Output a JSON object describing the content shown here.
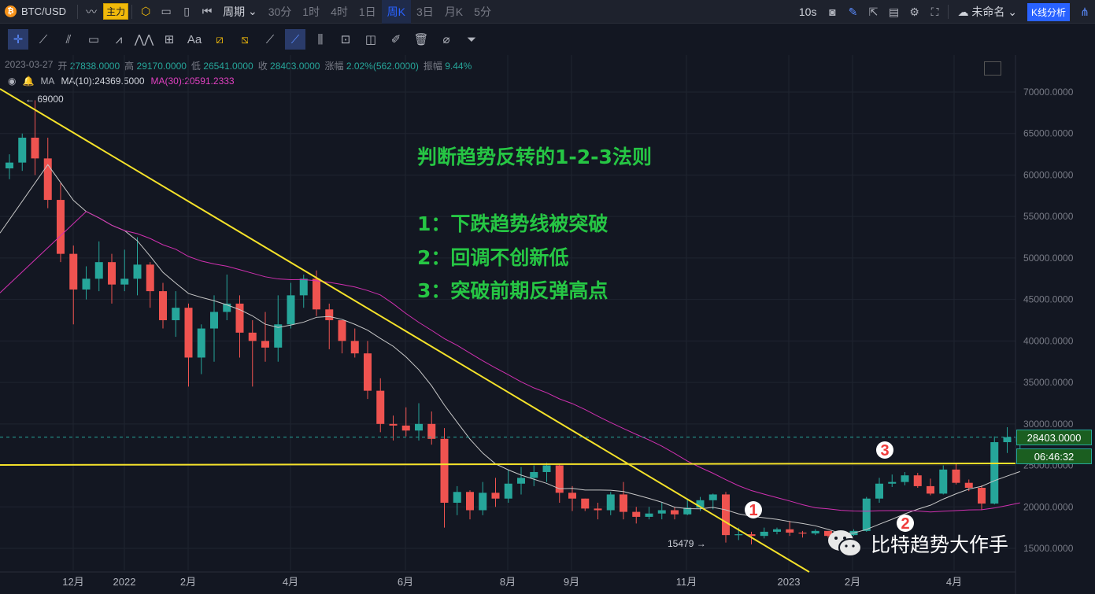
{
  "toolbar": {
    "symbol": "BTC/USD",
    "indicator_label": "主力",
    "period_label": "周期",
    "intervals": [
      "30分",
      "1时",
      "4时",
      "1日",
      "周K",
      "3日",
      "月K",
      "5分"
    ],
    "active_interval": "周K",
    "refresh": "10s",
    "layout_name": "未命名",
    "analysis_button": "K线分析"
  },
  "drawing_tools": [
    "crosshair",
    "trend-line",
    "ray",
    "rectangle",
    "pitchfork",
    "pattern",
    "measure",
    "text",
    "ruler",
    "fib",
    "brush",
    "magnet",
    "bars",
    "lock",
    "note",
    "edit",
    "delete",
    "magnet-2",
    "filter"
  ],
  "ohlc": {
    "date": "2023-03-27",
    "open_label": "开",
    "open": "27838.0000",
    "high_label": "高",
    "high": "29170.0000",
    "low_label": "低",
    "low": "26541.0000",
    "close_label": "收",
    "close": "28403.0000",
    "change_label": "涨幅",
    "change": "2.02%(562.0000)",
    "amplitude_label": "振幅",
    "amplitude": "9.44%"
  },
  "ma": {
    "label": "MA",
    "ma10": "MA(10):24369.5000",
    "ma30": "MA(30):20591.2333"
  },
  "annotations": {
    "title": "判断趋势反转的1-2-3法则",
    "rule1": "1：下跌趋势线被突破",
    "rule2": "2：回调不创新低",
    "rule3": "3：突破前期反弹高点"
  },
  "watermark": "比特趋势大作手",
  "price_labels": {
    "last": "28403.0000",
    "countdown": "06:46:32"
  },
  "chart_data": {
    "type": "candlestick",
    "y_ticks": [
      "70000.0000",
      "65000.0000",
      "60000.0000",
      "55000.0000",
      "50000.0000",
      "45000.0000",
      "40000.0000",
      "35000.0000",
      "30000.0000",
      "25000.0000",
      "20000.0000",
      "15000.0000"
    ],
    "ylim": [
      12000,
      74000
    ],
    "x_ticks": [
      "12月",
      "2022",
      "2月",
      "4月",
      "6月",
      "8月",
      "9月",
      "11月",
      "2023",
      "2月",
      "4月"
    ],
    "high_marker": "69000",
    "low_marker": "15479",
    "markers": [
      "1",
      "2",
      "3"
    ],
    "candles": [
      [
        60800,
        61500,
        59500,
        62500
      ],
      [
        61500,
        64500,
        60500,
        65000
      ],
      [
        64500,
        62000,
        60000,
        69000
      ],
      [
        62000,
        57000,
        56000,
        64500
      ],
      [
        57000,
        50500,
        49500,
        59000
      ],
      [
        50500,
        46200,
        42000,
        51500
      ],
      [
        46200,
        47500,
        45000,
        49000
      ],
      [
        47500,
        49500,
        46000,
        52000
      ],
      [
        49500,
        46800,
        44500,
        50500
      ],
      [
        46800,
        47500,
        46000,
        51000
      ],
      [
        47500,
        49200,
        45500,
        52500
      ],
      [
        49200,
        46000,
        44000,
        49500
      ],
      [
        46000,
        42500,
        41500,
        47000
      ],
      [
        42500,
        44000,
        40500,
        46000
      ],
      [
        44000,
        38000,
        34500,
        44500
      ],
      [
        38000,
        41500,
        36000,
        42000
      ],
      [
        41500,
        43500,
        37500,
        45500
      ],
      [
        43500,
        44500,
        42500,
        48000
      ],
      [
        44500,
        41000,
        38000,
        45500
      ],
      [
        41000,
        40000,
        34500,
        42500
      ],
      [
        40000,
        39200,
        37500,
        43500
      ],
      [
        39200,
        42000,
        37500,
        45500
      ],
      [
        42000,
        45500,
        41500,
        47000
      ],
      [
        45500,
        47500,
        44000,
        48000
      ],
      [
        47500,
        43800,
        43000,
        48500
      ],
      [
        43800,
        42500,
        39000,
        44500
      ],
      [
        42500,
        40000,
        38500,
        42500
      ],
      [
        40000,
        38500,
        38000,
        41500
      ],
      [
        38500,
        34000,
        33000,
        40000
      ],
      [
        34000,
        30000,
        29000,
        35500
      ],
      [
        30000,
        29800,
        28000,
        31000
      ],
      [
        29800,
        29200,
        28500,
        32000
      ],
      [
        29200,
        30000,
        28000,
        32500
      ],
      [
        30000,
        28200,
        27500,
        31500
      ],
      [
        28200,
        20500,
        17500,
        29500
      ],
      [
        20500,
        21800,
        19000,
        22500
      ],
      [
        21800,
        19600,
        18500,
        22000
      ],
      [
        19600,
        21700,
        19000,
        23000
      ],
      [
        21700,
        21000,
        20000,
        23500
      ],
      [
        21000,
        22800,
        20500,
        24500
      ],
      [
        22800,
        23500,
        21500,
        24800
      ],
      [
        23500,
        24200,
        22500,
        25000
      ],
      [
        24200,
        25000,
        23000,
        25300
      ],
      [
        25000,
        21700,
        20500,
        25200
      ],
      [
        21700,
        21000,
        19500,
        22500
      ],
      [
        21000,
        19800,
        19500,
        21000
      ],
      [
        19800,
        19600,
        18500,
        20500
      ],
      [
        19600,
        21500,
        19000,
        21800
      ],
      [
        21500,
        19400,
        18500,
        23000
      ],
      [
        19400,
        18800,
        18000,
        20000
      ],
      [
        18800,
        19200,
        18500,
        20000
      ],
      [
        19200,
        19600,
        18500,
        20500
      ],
      [
        19600,
        19100,
        18500,
        20000
      ],
      [
        19100,
        19900,
        19000,
        21000
      ],
      [
        19900,
        20800,
        19500,
        21200
      ],
      [
        20800,
        21500,
        19700,
        21600
      ],
      [
        21500,
        16600,
        15700,
        21800
      ],
      [
        16600,
        16700,
        16000,
        17500
      ],
      [
        16700,
        16500,
        15479,
        17000
      ],
      [
        16500,
        17000,
        16200,
        17500
      ],
      [
        17000,
        17300,
        16700,
        17500
      ],
      [
        17300,
        16900,
        16500,
        18300
      ],
      [
        16900,
        16800,
        16300,
        17100
      ],
      [
        16800,
        17100,
        16600,
        17300
      ],
      [
        17100,
        16500,
        16300,
        17000
      ],
      [
        16500,
        16600,
        16400,
        16900
      ],
      [
        16600,
        17100,
        16500,
        17300
      ],
      [
        17100,
        21000,
        17000,
        21200
      ],
      [
        21000,
        22800,
        20500,
        23500
      ],
      [
        22800,
        23000,
        22400,
        23900
      ],
      [
        23000,
        23800,
        22600,
        24200
      ],
      [
        23800,
        22500,
        22300,
        24100
      ],
      [
        22500,
        21600,
        21400,
        23400
      ],
      [
        21600,
        24500,
        21500,
        25000
      ],
      [
        24500,
        22900,
        22700,
        25200
      ],
      [
        22900,
        22300,
        21900,
        23300
      ],
      [
        22300,
        20400,
        19600,
        22600
      ],
      [
        20400,
        27800,
        20300,
        28500
      ],
      [
        27800,
        28400,
        26500,
        29600
      ],
      [
        27838,
        28403,
        26541,
        29170
      ]
    ]
  }
}
